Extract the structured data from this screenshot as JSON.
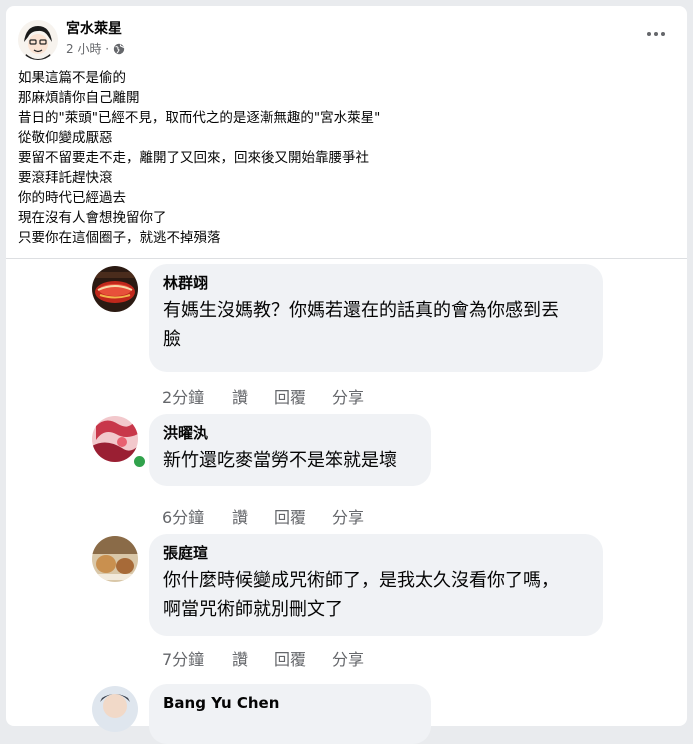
{
  "post": {
    "author": "宮水萊星",
    "time": "2 小時 ·",
    "audience_icon": "globe-icon",
    "more_icon": "more-options-icon",
    "lines": [
      "如果這篇不是偷的",
      "那麻煩請你自己離開",
      "昔日的\"萊頭\"已經不見，取而代之的是逐漸無趣的\"宮水萊星\"",
      "從敬仰變成厭惡",
      "要留不留要走不走，離開了又回來，回來後又開始靠腰爭社",
      "要滾拜託趕快滾",
      "你的時代已經過去",
      "現在沒有人會想挽留你了",
      "只要你在這個圈子，就逃不掉殞落"
    ]
  },
  "comments": [
    {
      "name": "林群翊",
      "text_lines": [
        "有媽生沒媽教？你媽若還在的話真的會為你感到丟",
        "臉"
      ],
      "time": "2分鐘",
      "like": "讚",
      "reply": "回覆",
      "share": "分享"
    },
    {
      "name": "洪曜汍",
      "text_lines": [
        "新竹還吃麥當勞不是笨就是壞"
      ],
      "time": "6分鐘",
      "like": "讚",
      "reply": "回覆",
      "share": "分享"
    },
    {
      "name": "張庭瑄",
      "text_lines": [
        "你什麼時候變成咒術師了，是我太久沒看你了嗎，",
        "啊當咒術師就別刪文了"
      ],
      "time": "7分鐘",
      "like": "讚",
      "reply": "回覆",
      "share": "分享"
    },
    {
      "name": "Bang Yu Chen"
    }
  ],
  "colors": {
    "background": "#e9ebee",
    "card": "#ffffff",
    "bubble": "#f0f2f5",
    "secondary_text": "#65676b",
    "online": "#31a24c"
  }
}
